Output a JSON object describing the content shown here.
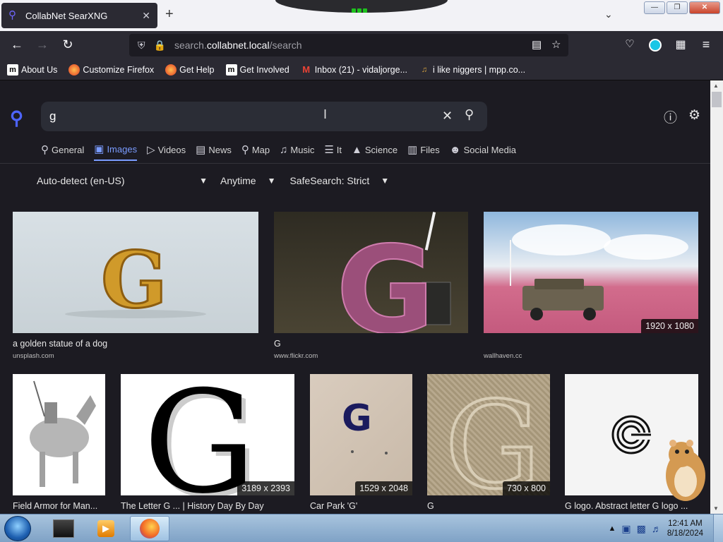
{
  "browser": {
    "tab_title": "CollabNet SearXNG",
    "url_prefix": "search.",
    "url_domain": "collabnet.local",
    "url_path": "/search",
    "bookmarks": [
      {
        "label": "About Us",
        "icon": "m"
      },
      {
        "label": "Customize Firefox",
        "icon": "firefox-icon"
      },
      {
        "label": "Get Help",
        "icon": "firefox-icon"
      },
      {
        "label": "Get Involved",
        "icon": "m"
      },
      {
        "label": "Inbox (21) - vidaljorge...",
        "icon": "gmail-icon"
      },
      {
        "label": "i like niggers | mpp.co...",
        "icon": "note-icon"
      }
    ]
  },
  "search": {
    "query": "g",
    "categories": [
      {
        "label": "General",
        "icon": "search-icon",
        "active": false
      },
      {
        "label": "Images",
        "icon": "image-icon",
        "active": true
      },
      {
        "label": "Videos",
        "icon": "play-icon",
        "active": false
      },
      {
        "label": "News",
        "icon": "newspaper-icon",
        "active": false
      },
      {
        "label": "Map",
        "icon": "map-pin-icon",
        "active": false
      },
      {
        "label": "Music",
        "icon": "music-icon",
        "active": false
      },
      {
        "label": "It",
        "icon": "layers-icon",
        "active": false
      },
      {
        "label": "Science",
        "icon": "graduation-icon",
        "active": false
      },
      {
        "label": "Files",
        "icon": "files-icon",
        "active": false
      },
      {
        "label": "Social Media",
        "icon": "people-icon",
        "active": false
      }
    ],
    "filters": {
      "language": "Auto-detect (en-US)",
      "time": "Anytime",
      "safesearch": "SafeSearch: Strict"
    }
  },
  "results": [
    {
      "title": "a golden statue of a dog",
      "source": "unsplash.com",
      "dims": ""
    },
    {
      "title": "G",
      "source": "www.flickr.com",
      "dims": ""
    },
    {
      "title": "",
      "source": "wallhaven.cc",
      "dims": "1920 x 1080"
    },
    {
      "title": "Field Armor for Man...",
      "source": "",
      "dims": ""
    },
    {
      "title": "The Letter G ... | History Day By Day",
      "source": "",
      "dims": "3189 x 2393"
    },
    {
      "title": "Car Park 'G'",
      "source": "",
      "dims": "1529 x 2048"
    },
    {
      "title": "G",
      "source": "",
      "dims": "730 x 800"
    },
    {
      "title": "G logo. Abstract letter G logo ...",
      "source": "",
      "dims": ""
    }
  ],
  "taskbar": {
    "time": "12:41 AM",
    "date": "8/18/2024"
  }
}
